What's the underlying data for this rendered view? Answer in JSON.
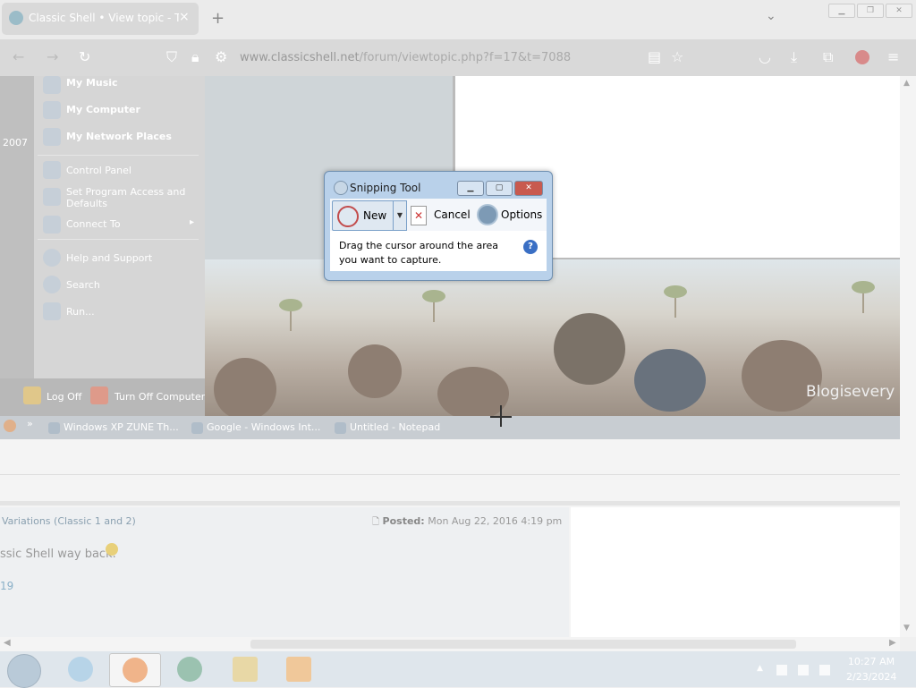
{
  "browser": {
    "tab_title": "Classic Shell • View topic - Take",
    "tab_close": "×",
    "new_tab": "+",
    "tab_list": "⌄",
    "url_host": "www.classicshell.net",
    "url_path": "/forum/viewtopic.php?f=17&t=7088"
  },
  "xp_start_menu": {
    "year_label": "2007",
    "items_bold": [
      "My Music",
      "My Computer",
      "My Network Places"
    ],
    "items": [
      "Control Panel",
      "Set Program Access and",
      "Defaults",
      "Connect To",
      "Help and Support",
      "Search",
      "Run..."
    ],
    "log_off": "Log Off",
    "turn_off": "Turn Off Computer",
    "submenu_arrow": "▸"
  },
  "xp_taskbar": {
    "tasks": [
      "Windows XP ZUNE Th...",
      "Google - Windows Int...",
      "Untitled - Notepad"
    ],
    "chevron": "»"
  },
  "photo": {
    "watermark": "Blogisevery"
  },
  "forum": {
    "post_subject": "Variations (Classic 1 and 2)",
    "posted_label": "Posted:",
    "posted_date": "Mon Aug 22, 2016 4:19 pm",
    "post_body": "ssic Shell way back.",
    "post_link": "19"
  },
  "snipping_tool": {
    "title": "Snipping Tool",
    "new_label": "New",
    "cancel_label": "Cancel",
    "options_label": "Options",
    "message_line1": "Drag the cursor around the area",
    "message_line2": "you want to capture.",
    "help": "?"
  },
  "taskbar": {
    "time": "10:27 AM",
    "date": "2/23/2024"
  }
}
